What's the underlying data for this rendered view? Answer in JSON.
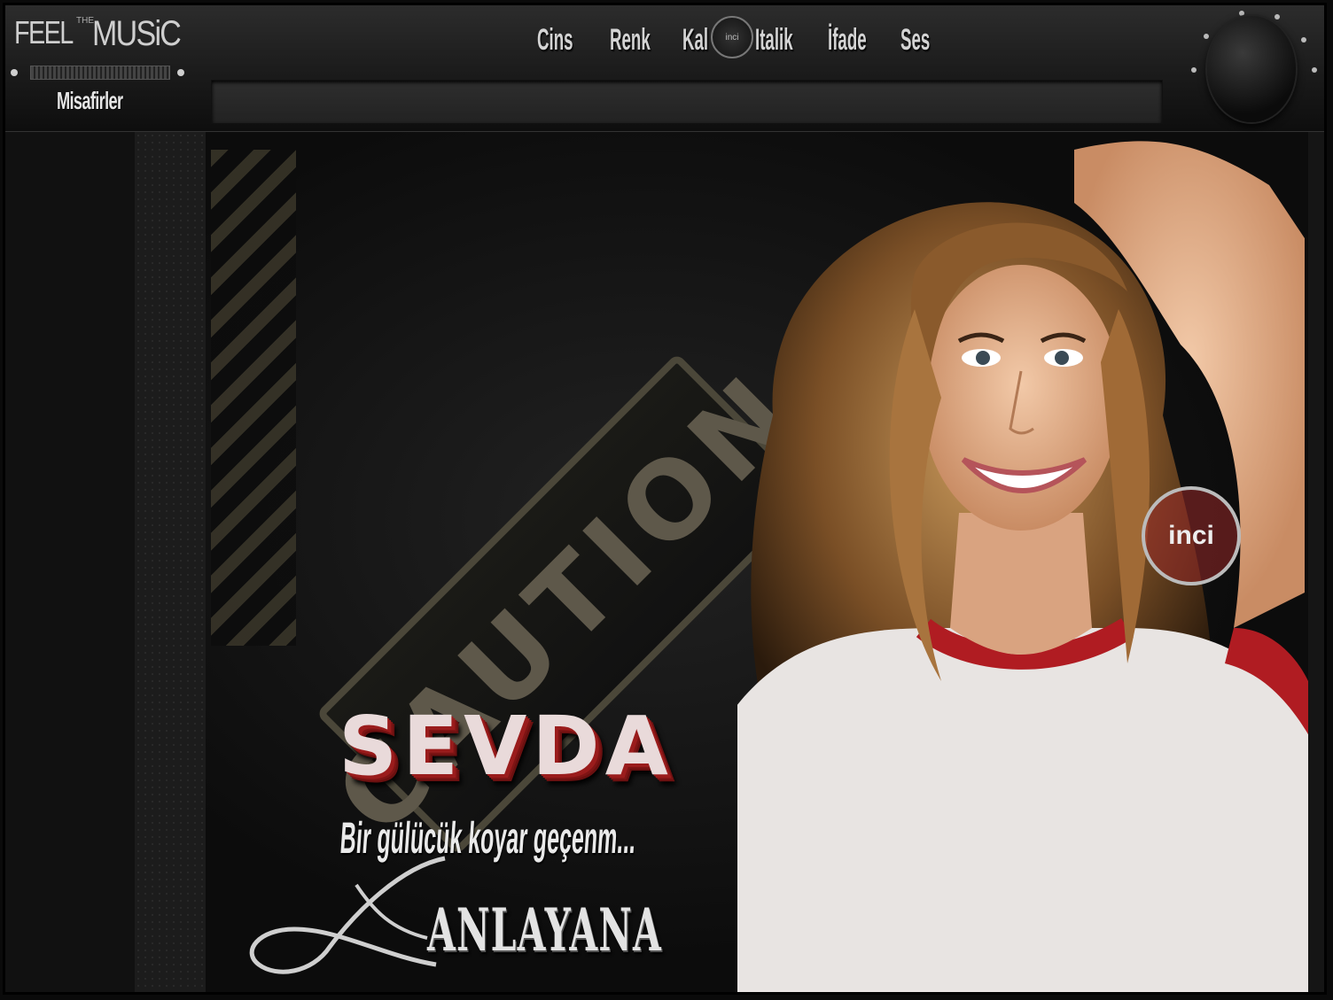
{
  "logo": {
    "feel": "FEEL",
    "the": "THE",
    "music": "MUSiC"
  },
  "user": {
    "name": "Misafirler"
  },
  "menu": {
    "items": [
      {
        "label": "Cins"
      },
      {
        "label": "Renk"
      },
      {
        "label": "Kal"
      },
      {
        "label": "Italik"
      },
      {
        "label": "İfade"
      },
      {
        "label": "Ses"
      }
    ],
    "badge": "inci"
  },
  "hero": {
    "title": "SEVDA",
    "subtitle": "Bir gülücük koyar geçenm...",
    "tagline": "ANLAYANA",
    "sign_text": "CAUTION",
    "watermark": "inci"
  },
  "colors": {
    "accent": "#9a1c1c",
    "text": "#e9dada",
    "bar": "#2c2c2c"
  }
}
